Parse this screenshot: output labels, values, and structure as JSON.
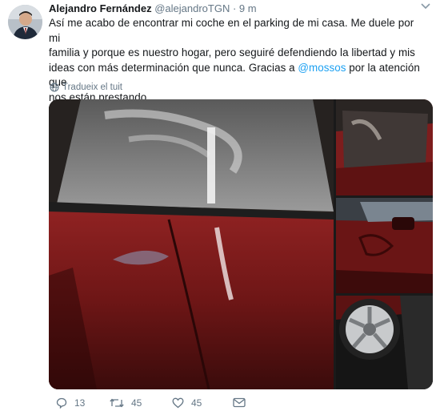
{
  "tweet": {
    "author_name": "Alejandro Fernández",
    "author_handle": "@alejandroTGN",
    "separator": "·",
    "time": "9 m",
    "text_line1": "Así me acabo de encontrar mi coche en el parking de mi casa. Me duele por mi",
    "text_line2": "familia y porque es nuestro hogar, pero seguiré defendiendo la libertad y mis",
    "text_line3_before": "ideas con más determinación que nunca. Gracias a ",
    "mention": "@mossos",
    "text_line3_after": " por la atención que",
    "text_line4": "nos están prestando.",
    "translate_label": "Tradueix el tuit"
  },
  "actions": {
    "replies": "13",
    "retweets": "45",
    "likes": "45"
  },
  "icons": {
    "translate": "globe-icon",
    "reply": "reply-icon",
    "retweet": "retweet-icon",
    "like": "heart-icon",
    "message": "envelope-icon",
    "menu": "chevron-down-icon"
  },
  "colors": {
    "link": "#1da1f2",
    "secondary_text": "#657786",
    "car_red": "#7a1a1a"
  }
}
